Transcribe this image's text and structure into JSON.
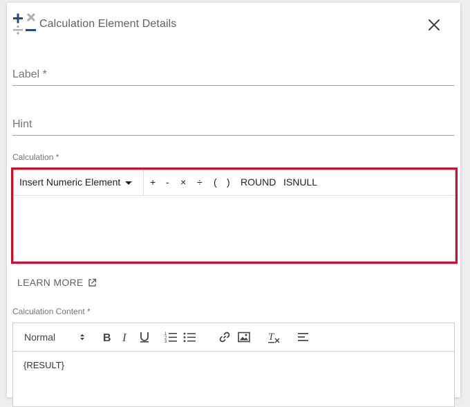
{
  "dialog": {
    "title": "Calculation Element Details",
    "close_icon": "close-icon",
    "logo_icon": "calculator-operators-icon"
  },
  "fields": {
    "label": {
      "placeholder": "Label *",
      "value": ""
    },
    "hint": {
      "placeholder": "Hint",
      "value": ""
    }
  },
  "calculation": {
    "label": "Calculation *",
    "insert_label": "Insert Numeric Element",
    "operators": [
      "+",
      "-",
      "×",
      "÷",
      "(",
      ")",
      "ROUND",
      "ISNULL"
    ],
    "content": ""
  },
  "learn_more": {
    "label": "LEARN MORE",
    "icon": "external-link-icon"
  },
  "calculation_content": {
    "label": "Calculation Content *",
    "format_select": "Normal",
    "toolbar_icons": [
      "bold-icon",
      "italic-icon",
      "underline-icon",
      "ordered-list-icon",
      "bullet-list-icon",
      "link-icon",
      "image-icon",
      "clear-format-icon",
      "align-left-icon"
    ],
    "content": "{RESULT}"
  },
  "colors": {
    "highlight": "#c8102e",
    "logo_blue": "#1f4e79",
    "logo_gray": "#b0b0b0"
  }
}
